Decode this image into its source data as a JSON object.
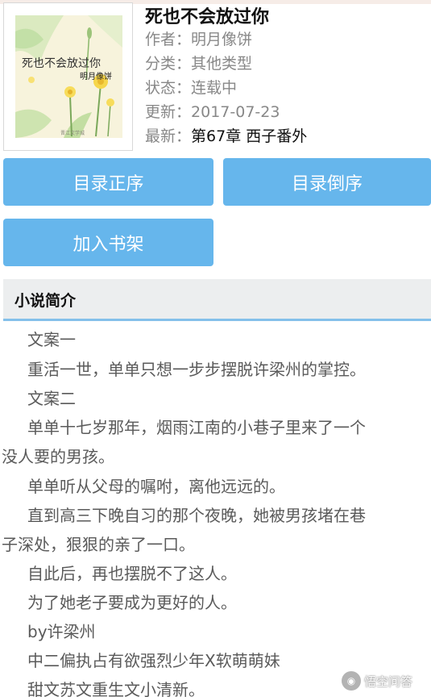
{
  "book": {
    "title": "死也不会放过你",
    "cover": {
      "title_text": "死也不会放过你",
      "author_text": "明月像饼",
      "publisher_text": "晋江文学城"
    },
    "meta": [
      {
        "label": "作者：",
        "value": "明月像饼"
      },
      {
        "label": "分类：",
        "value": "其他类型"
      },
      {
        "label": "状态：",
        "value": "连载中"
      },
      {
        "label": "更新：",
        "value": "2017-07-23"
      },
      {
        "label": "最新：",
        "value": "第67章 西子番外"
      }
    ]
  },
  "buttons": {
    "catalog_asc": "目录正序",
    "catalog_desc": "目录倒序",
    "add_shelf": "加入书架"
  },
  "section": {
    "title": "小说简介"
  },
  "synopsis": [
    "　文案一",
    "　重活一世，单单只想一步步摆脱许梁州的掌控。",
    "　文案二",
    "　单单十七岁那年，烟雨江南的小巷子里来了一个",
    "没人要的男孩。",
    "　单单听从父母的嘱咐，离他远远的。",
    "　直到高三下晚自习的那个夜晚，她被男孩堵在巷",
    "子深处，狠狠的亲了一口。",
    "　自此后，再也摆脱不了这人。",
    "　为了她老子要成为更好的人。",
    "　by许梁州",
    "　中二偏执占有欲强烈少年X软萌萌妹",
    "　甜文苏文重生文小清新。"
  ],
  "watermark": {
    "text": "悟空问答",
    "icon": "wukong-logo-icon"
  },
  "colors": {
    "button": "#66b6ec",
    "section_underline": "#84c0ea",
    "section_bg": "#eceeef"
  }
}
